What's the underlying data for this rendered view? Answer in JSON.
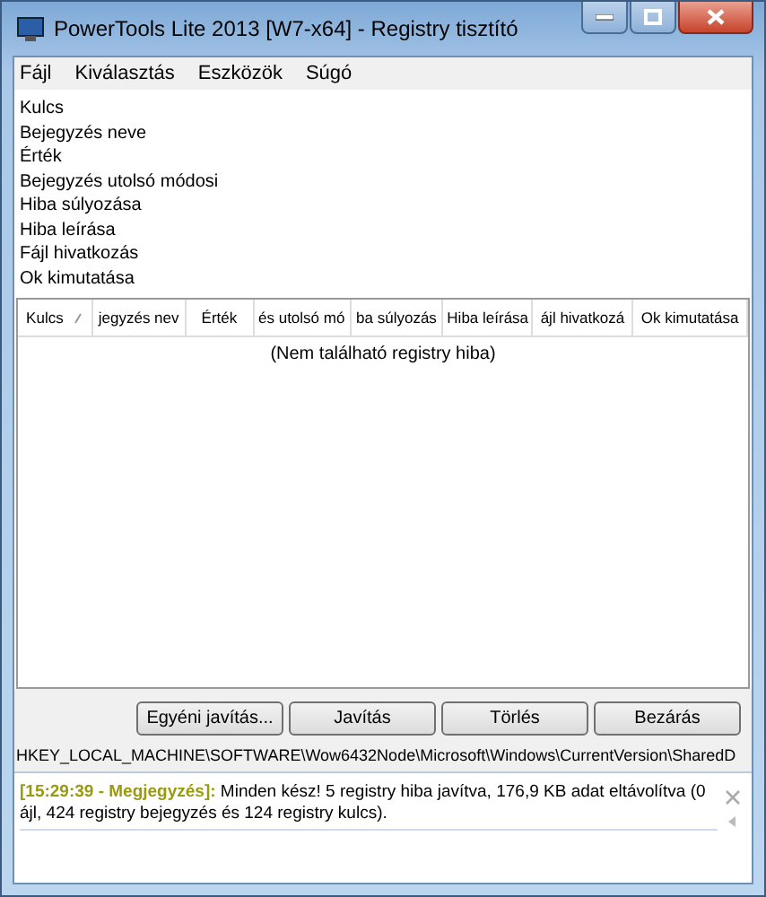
{
  "window": {
    "title": "PowerTools Lite 2013 [W7-x64] - Registry tisztító"
  },
  "menu": [
    {
      "label": "Fájl"
    },
    {
      "label": "Kiválasztás"
    },
    {
      "label": "Eszközök"
    },
    {
      "label": "Súgó"
    }
  ],
  "field_list": [
    "Kulcs",
    "Bejegyzés neve",
    "Érték",
    "Bejegyzés utolsó módosi",
    "Hiba súlyozása",
    "Hiba leírása",
    "Fájl hivatkozás",
    "Ok kimutatása"
  ],
  "table": {
    "columns": [
      {
        "label": "Kulcs",
        "sorted": true
      },
      {
        "label": "jegyzés nev",
        "sorted": false
      },
      {
        "label": "Érték",
        "sorted": false
      },
      {
        "label": "és utolsó mó",
        "sorted": false
      },
      {
        "label": "ba súlyozás",
        "sorted": false
      },
      {
        "label": "Hiba leírása",
        "sorted": false
      },
      {
        "label": "ájl hivatkozá",
        "sorted": false
      },
      {
        "label": "Ok kimutatása",
        "sorted": false
      }
    ],
    "empty_message": "(Nem található registry hiba)"
  },
  "buttons": [
    "Egyéni javítás...",
    "Javítás",
    "Törlés",
    "Bezárás"
  ],
  "path": "HKEY_LOCAL_MACHINE\\SOFTWARE\\Wow6432Node\\Microsoft\\Windows\\CurrentVersion\\SharedD",
  "log": {
    "stamp": "[15:29:39 - Megjegyzés]:",
    "message": "Minden kész! 5 registry hiba javítva, 176,9 KB adat eltávolítva (0 ájl, 424 registry bejegyzés és 124 registry kulcs)."
  }
}
